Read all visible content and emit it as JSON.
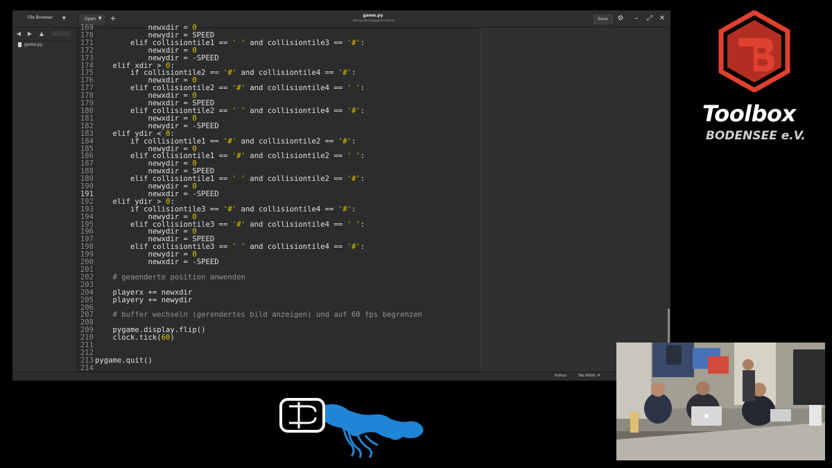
{
  "window": {
    "title": "game.py",
    "subtitle": "~/Dev/projects/pygame-tutorial",
    "sidebar_title": "File Browser",
    "open_label": "Open",
    "save_label": "Save"
  },
  "sidebar": {
    "folder_label": "...",
    "files": [
      {
        "name": "game.py"
      }
    ]
  },
  "editor": {
    "current_line": 191,
    "lines": [
      {
        "n": "169",
        "code": "            newxdir = 0"
      },
      {
        "n": "170",
        "code": "            newydir = SPEED"
      },
      {
        "n": "171",
        "code": "        elif collisiontile1 == ' ' and collisiontile3 == '#':"
      },
      {
        "n": "172",
        "code": "            newxdir = 0"
      },
      {
        "n": "173",
        "code": "            newydir = -SPEED"
      },
      {
        "n": "174",
        "code": "    elif xdir > 0:"
      },
      {
        "n": "175",
        "code": "        if collisiontile2 == '#' and collisiontile4 == '#':"
      },
      {
        "n": "176",
        "code": "            newxdir = 0"
      },
      {
        "n": "177",
        "code": "        elif collisiontile2 == '#' and collisiontile4 == ' ':"
      },
      {
        "n": "178",
        "code": "            newxdir = 0"
      },
      {
        "n": "179",
        "code": "            newxdir = SPEED"
      },
      {
        "n": "180",
        "code": "        elif collisiontile2 == ' ' and collisiontile4 == '#':"
      },
      {
        "n": "181",
        "code": "            newxdir = 0"
      },
      {
        "n": "182",
        "code": "            newydir = -SPEED"
      },
      {
        "n": "183",
        "code": "    elif ydir < 0:"
      },
      {
        "n": "184",
        "code": "        if collisiontile1 == '#' and collisiontile2 == '#':"
      },
      {
        "n": "185",
        "code": "            newydir = 0"
      },
      {
        "n": "186",
        "code": "        elif collisiontile1 == '#' and collisiontile2 == ' ':"
      },
      {
        "n": "187",
        "code": "            newydir = 0"
      },
      {
        "n": "188",
        "code": "            newxdir = SPEED"
      },
      {
        "n": "189",
        "code": "        elif collisiontile1 == ' ' and collisiontile2 == '#':"
      },
      {
        "n": "190",
        "code": "            newydir = 0"
      },
      {
        "n": "191",
        "code": "            newxdir = -SPEED"
      },
      {
        "n": "192",
        "code": "    elif ydir > 0:"
      },
      {
        "n": "193",
        "code": "        if collisiontile3 == '#' and collisiontile4 == '#':"
      },
      {
        "n": "194",
        "code": "            newydir = 0"
      },
      {
        "n": "195",
        "code": "        elif collisiontile3 == '#' and collisiontile4 == ' ':"
      },
      {
        "n": "196",
        "code": "            newydir = 0"
      },
      {
        "n": "197",
        "code": "            newxdir = SPEED"
      },
      {
        "n": "198",
        "code": "        elif collisiontile3 == ' ' and collisiontile4 == '#':"
      },
      {
        "n": "199",
        "code": "            newydir = 0"
      },
      {
        "n": "200",
        "code": "            newxdir = -SPEED"
      },
      {
        "n": "201",
        "code": ""
      },
      {
        "n": "202",
        "code": "    # geaenderte position anwenden"
      },
      {
        "n": "203",
        "code": ""
      },
      {
        "n": "204",
        "code": "    playerx += newxdir"
      },
      {
        "n": "205",
        "code": "    playery += newydir"
      },
      {
        "n": "206",
        "code": ""
      },
      {
        "n": "207",
        "code": "    # buffer wechseln (gerendertes bild anzeigen) und auf 60 fps begrenzen"
      },
      {
        "n": "208",
        "code": ""
      },
      {
        "n": "209",
        "code": "    pygame.display.flip()"
      },
      {
        "n": "210",
        "code": "    clock.tick(60)"
      },
      {
        "n": "211",
        "code": ""
      },
      {
        "n": "212",
        "code": ""
      },
      {
        "n": "213",
        "code": "pygame.quit()"
      },
      {
        "n": "214",
        "code": ""
      }
    ]
  },
  "statusbar": {
    "language": "Python",
    "tab_width": "Tab Width: 4"
  },
  "branding": {
    "name": "Toolbox",
    "subname": "BODENSEE e.V.",
    "logo_color": "#e0402f"
  },
  "colors": {
    "keyword_number": "#e6c200",
    "comment": "#8f9490",
    "text": "#e0e0e0"
  }
}
